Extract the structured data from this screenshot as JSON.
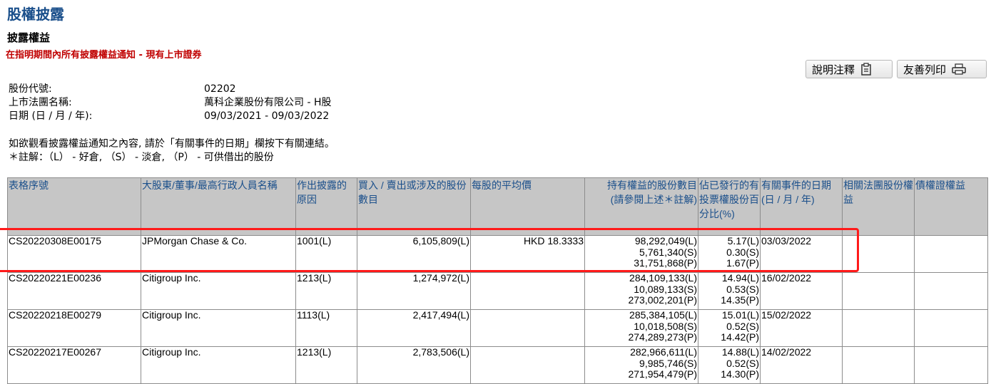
{
  "page": {
    "title": "股權披露",
    "subtitle": "披露權益",
    "notice": "在指明期間內所有披露權益通知 - 現有上市證券"
  },
  "buttons": {
    "notes_label": "說明注釋",
    "print_label": "友善列印"
  },
  "info": {
    "stock_code_label": "股份代號:",
    "stock_code": "02202",
    "company_label": "上市法團名稱:",
    "company": "萬科企業股份有限公司 - H股",
    "date_label": "日期 (日 / 月 / 年):",
    "date_range": "09/03/2021 - 09/03/2022"
  },
  "notes": {
    "line1": "如欲觀看披露權益通知之內容, 請於「有關事件的日期」欄按下有關連結。",
    "line2": "＊註解：（L） - 好倉, （S） - 淡倉, （P） - 可供借出的股份"
  },
  "table": {
    "headers": [
      "表格序號",
      "大股東/董事/最高行政人員名稱",
      "作出披露的原因",
      "買入 / 賣出或涉及的股份數目",
      "每股的平均價",
      "持有權益的股份數目\n(請參閱上述＊註解)",
      "佔已發行的有投票權股份百分比(%)",
      "有關事件的日期(日 / 月 / 年)",
      "相關法團股份權益",
      "債權證權益"
    ],
    "rows": [
      {
        "form": "CS20220308E00175",
        "name": "JPMorgan Chase & Co.",
        "reason": "1001(L)",
        "shares": "6,105,809(L)",
        "price": "HKD 18.3333",
        "holdings": [
          "98,292,049(L)",
          "5,761,340(S)",
          "31,751,868(P)"
        ],
        "pcts": [
          "5.17(L)",
          "0.30(S)",
          "1.67(P)"
        ],
        "date": "03/03/2022",
        "assoc": "",
        "deb": ""
      },
      {
        "form": "CS20220221E00236",
        "name": "Citigroup Inc.",
        "reason": "1213(L)",
        "shares": "1,274,972(L)",
        "price": "",
        "holdings": [
          "284,109,133(L)",
          "10,089,133(S)",
          "273,002,201(P)"
        ],
        "pcts": [
          "14.94(L)",
          "0.53(S)",
          "14.35(P)"
        ],
        "date": "16/02/2022",
        "assoc": "",
        "deb": ""
      },
      {
        "form": "CS20220218E00279",
        "name": "Citigroup Inc.",
        "reason": "1113(L)",
        "shares": "2,417,494(L)",
        "price": "",
        "holdings": [
          "285,384,105(L)",
          "10,018,508(S)",
          "274,289,273(P)"
        ],
        "pcts": [
          "15.01(L)",
          "0.52(S)",
          "14.42(P)"
        ],
        "date": "15/02/2022",
        "assoc": "",
        "deb": ""
      },
      {
        "form": "CS20220217E00267",
        "name": "Citigroup Inc.",
        "reason": "1213(L)",
        "shares": "2,783,506(L)",
        "price": "",
        "holdings": [
          "282,966,611(L)",
          "9,985,746(S)",
          "271,954,479(P)"
        ],
        "pcts": [
          "14.88(L)",
          "0.52(S)",
          "14.30(P)"
        ],
        "date": "14/02/2022",
        "assoc": "",
        "deb": ""
      }
    ]
  },
  "colors": {
    "title_blue": "#1a4f8b",
    "notice_red": "#c00000",
    "header_gray": "#c6c6c6",
    "highlight_red": "#ff1a1a"
  },
  "icons": {
    "notes": "clipboard-icon",
    "print": "printer-icon"
  }
}
